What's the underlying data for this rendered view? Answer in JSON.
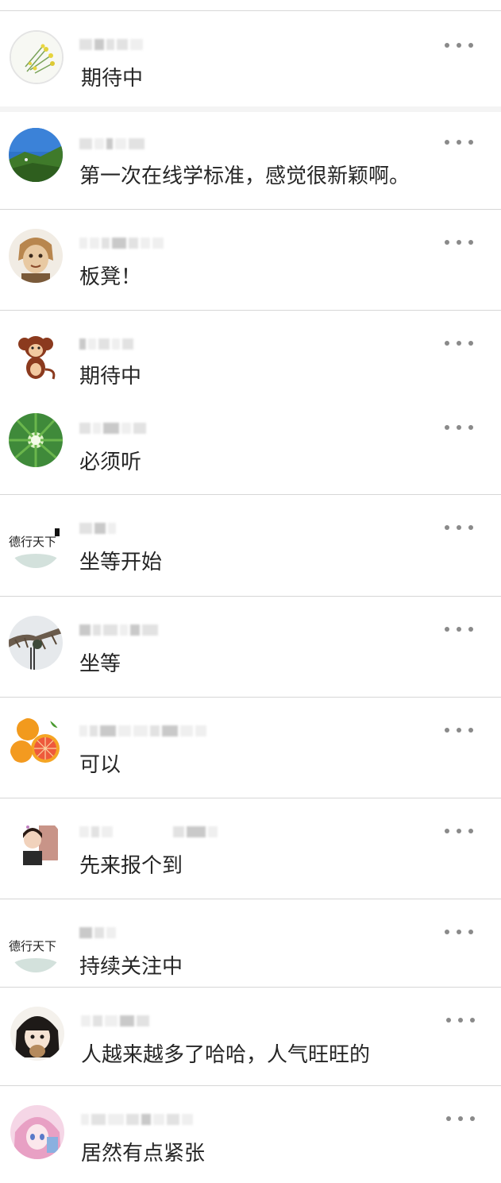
{
  "comments": [
    {
      "text": "期待中",
      "avatar": "flower-sketch-icon"
    },
    {
      "text": "第一次在线学标准，感觉很新颖啊。",
      "avatar": "mountain-sky-icon"
    },
    {
      "text": "板凳！",
      "avatar": "monkey-king-icon"
    },
    {
      "text": "期待中",
      "avatar": "cartoon-monkey-icon"
    },
    {
      "text": "必须听",
      "avatar": "bamboo-forest-icon"
    },
    {
      "text": "坐等开始",
      "avatar": "calligraphy-icon",
      "avatar_text": "德行天下"
    },
    {
      "text": "坐等",
      "avatar": "tree-silhouette-icon"
    },
    {
      "text": "可以",
      "avatar": "grapefruit-icon"
    },
    {
      "text": "先来报个到",
      "avatar": "portrait-woman-icon"
    },
    {
      "text": "持续关注中",
      "avatar": "calligraphy-icon",
      "avatar_text": "德行天下"
    },
    {
      "text": "人越来越多了哈哈，人气旺旺的",
      "avatar": "cartoon-girl-icon"
    },
    {
      "text": "居然有点紧张",
      "avatar": "anime-pink-hair-icon"
    }
  ],
  "colors": {
    "text": "#262626",
    "separator": "#d6d6d6",
    "more_dots": "#8a8a8a"
  }
}
